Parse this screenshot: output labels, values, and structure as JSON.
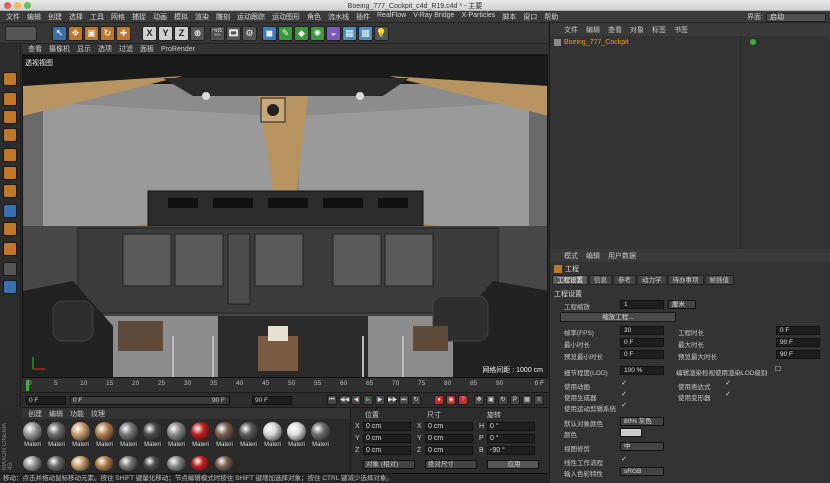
{
  "window": {
    "title": "Boeing_777_Cockpit_c4d_R19.c4d * - 主要",
    "interface_label": "界面:",
    "interface_value": "启动"
  },
  "menubar": [
    "文件",
    "编辑",
    "创建",
    "选择",
    "工具",
    "网格",
    "捕捉",
    "动画",
    "模拟",
    "渲染",
    "雕刻",
    "运动跟踪",
    "运动图形",
    "角色",
    "流水线",
    "插件",
    "RealFlow",
    "V-Ray Bridge",
    "X-Particles",
    "脚本",
    "窗口",
    "帮助"
  ],
  "toolbar": {
    "axis_x": "X",
    "axis_y": "Y",
    "axis_z": "Z"
  },
  "viewport": {
    "menu": [
      "查看",
      "摄像机",
      "显示",
      "选项",
      "过滤",
      "面板",
      "ProRender"
    ],
    "label": "透视视图",
    "grid_info": "网格间距 : 1000 cm"
  },
  "timeline": {
    "ticks": [
      "0",
      "5",
      "10",
      "15",
      "20",
      "25",
      "30",
      "35",
      "40",
      "45",
      "50",
      "55",
      "60",
      "65",
      "70",
      "75",
      "80",
      "85",
      "90"
    ],
    "end_frame": "0 F",
    "start_field": "0 F",
    "current_field": "0 F",
    "max_field": "90 F",
    "end_field": "90 F"
  },
  "materials": {
    "menu": [
      "创建",
      "编辑",
      "功能",
      "纹理"
    ],
    "items": [
      {
        "label": "Materi",
        "color": "#9a9a9a"
      },
      {
        "label": "Materi",
        "color": "#6b6b6b"
      },
      {
        "label": "Materi",
        "color": "#c8a070"
      },
      {
        "label": "Materi",
        "color": "#b08050"
      },
      {
        "label": "Materi",
        "color": "#7a7a7a"
      },
      {
        "label": "Materi",
        "color": "#4a4a4a"
      },
      {
        "label": "Materi",
        "color": "#8c8c8c"
      },
      {
        "label": "Materi",
        "color": "#c02020"
      },
      {
        "label": "Materi",
        "color": "#7a6050"
      },
      {
        "label": "Materi",
        "color": "#5a5a5a"
      },
      {
        "label": "Materi",
        "color": "#d8d8d8"
      },
      {
        "label": "Materi",
        "color": "#e0e0e0"
      },
      {
        "label": "Materi",
        "color": "#6e6e6e"
      }
    ],
    "row2_count": 9,
    "brand": "MAXON CINEMA 4D"
  },
  "coordinates": {
    "headers": {
      "position": "位置",
      "size": "尺寸",
      "rotation": "旋转"
    },
    "rows": [
      {
        "axis": "X",
        "pos": "0 cm",
        "size_axis": "X",
        "size": "0 cm",
        "rot_axis": "H",
        "rot": "0 °"
      },
      {
        "axis": "Y",
        "pos": "0 cm",
        "size_axis": "Y",
        "size": "0 cm",
        "rot_axis": "P",
        "rot": "0 °"
      },
      {
        "axis": "Z",
        "pos": "0 cm",
        "size_axis": "Z",
        "size": "0 cm",
        "rot_axis": "B",
        "rot": "-90 °"
      }
    ],
    "mode": "对象 (相对)",
    "size_mode": "绝对尺寸",
    "apply": "应用"
  },
  "status": "移动：点击并拖动鼠标移动元素。按住 SHIFT 键量化移动；节点编辑模式时按住 SHIFT 键增加选择对象；按住 CTRL 键减少选择对象。",
  "object_manager": {
    "menu": [
      "文件",
      "编辑",
      "查看",
      "对象",
      "标签",
      "书签"
    ],
    "root_object": "Boeing_777_Cockpit"
  },
  "attributes": {
    "menu": [
      "模式",
      "编辑",
      "用户数据"
    ],
    "title": "工程",
    "tabs": [
      "工程设置",
      "信息",
      "参考",
      "动力学",
      "待办事项",
      "帧插值"
    ],
    "section": "工程设置",
    "scale_label": "工程缩放",
    "scale_value": "1",
    "scale_unit": "厘米",
    "scale_button": "缩放工程...",
    "fps_label": "帧率(FPS)",
    "fps": "30",
    "duration_label": "工程时长",
    "duration": "0 F",
    "min_time_label": "最小时长",
    "min_time": "0 F",
    "max_time_label": "最大时长",
    "max_time": "90 F",
    "prev_min_label": "预览最小时长",
    "prev_min": "0 F",
    "prev_max_label": "预览最大时长",
    "prev_max": "90 F",
    "lod_label": "细节程度(LOD)",
    "lod": "100 %",
    "lod_render_label": "编辑渲染检视使用渲染LOD级别",
    "use_anim": "使用动画",
    "use_expr": "使用表达式",
    "use_gen": "使用生成器",
    "use_deform": "使用变形器",
    "use_motion": "使用运动剪辑系统",
    "default_color_label": "默认对象颜色",
    "default_color": "80% 灰色",
    "color_label": "颜色",
    "view_clip_label": "视图修剪",
    "view_clip": "中",
    "linear_label": "线性工作流程",
    "input_color_label": "输入色彩特性",
    "input_color": "sRGB"
  }
}
